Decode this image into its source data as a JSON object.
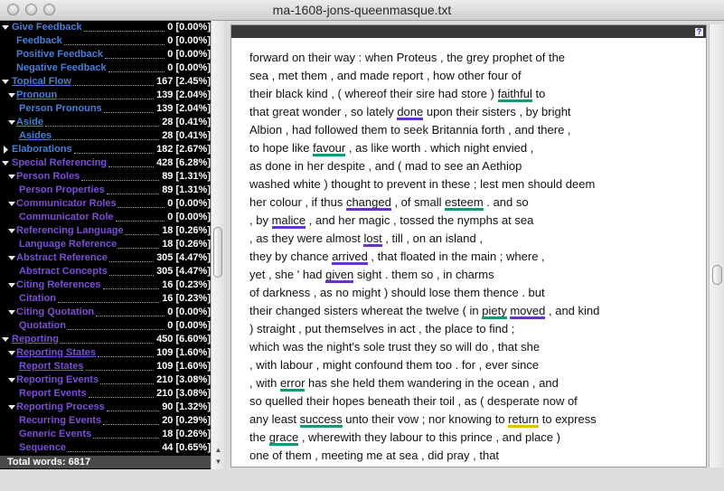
{
  "window": {
    "title": "ma-1608-jons-queenmasque.txt"
  },
  "colors": {
    "purple": "#6633cc",
    "teal": "#119977",
    "yellow": "#e6c000",
    "blue_label": "#3366cc",
    "purple_label": "#7a4fd4"
  },
  "tree": [
    {
      "label": "Give Feedback",
      "value": "0 [0.00%]",
      "level": 0,
      "tri": "down",
      "color": "#4a7fd8"
    },
    {
      "label": "Feedback",
      "value": "0 [0.00%]",
      "level": 1,
      "tri": "",
      "color": "#4a7fd8"
    },
    {
      "label": "Positive Feedback",
      "value": "0 [0.00%]",
      "level": 1,
      "tri": "",
      "color": "#4a7fd8"
    },
    {
      "label": "Negative Feedback",
      "value": "0 [0.00%]",
      "level": 1,
      "tri": "",
      "color": "#4a7fd8"
    },
    {
      "label": "Topical Flow",
      "value": "167 [2.45%]",
      "level": 0,
      "tri": "down",
      "color": "#4a7fd8",
      "underline": true
    },
    {
      "label": "Pronoun",
      "value": "139 [2.04%]",
      "level": 1,
      "tri": "down",
      "color": "#4a7fd8",
      "underline": true,
      "tri_offset": true
    },
    {
      "label": "Person Pronouns",
      "value": "139 [2.04%]",
      "level": 2,
      "tri": "",
      "color": "#4a7fd8"
    },
    {
      "label": "Aside",
      "value": "28 [0.41%]",
      "level": 1,
      "tri": "down",
      "color": "#4a7fd8",
      "underline": true,
      "tri_offset": true
    },
    {
      "label": "Asides",
      "value": "28 [0.41%]",
      "level": 2,
      "tri": "",
      "color": "#4a7fd8",
      "underline": true
    },
    {
      "label": "Elaborations",
      "value": "182 [2.67%]",
      "level": 0,
      "tri": "right",
      "color": "#4a7fd8"
    },
    {
      "label": "Special Referencing",
      "value": "428 [6.28%]",
      "level": 0,
      "tri": "down",
      "color": "#7a4fd4"
    },
    {
      "label": "Person Roles",
      "value": "89 [1.31%]",
      "level": 1,
      "tri": "down",
      "color": "#7a4fd4",
      "tri_offset": true
    },
    {
      "label": "Person Properties",
      "value": "89 [1.31%]",
      "level": 2,
      "tri": "",
      "color": "#7a4fd4"
    },
    {
      "label": "Communicator Roles",
      "value": "0 [0.00%]",
      "level": 1,
      "tri": "down",
      "color": "#7a4fd4",
      "tri_offset": true
    },
    {
      "label": "Communicator Role",
      "value": "0 [0.00%]",
      "level": 2,
      "tri": "",
      "color": "#7a4fd4"
    },
    {
      "label": "Referencing Language",
      "value": "18 [0.26%]",
      "level": 1,
      "tri": "down",
      "color": "#7a4fd4",
      "tri_offset": true
    },
    {
      "label": "Language Reference",
      "value": "18 [0.26%]",
      "level": 2,
      "tri": "",
      "color": "#7a4fd4"
    },
    {
      "label": "Abstract Reference",
      "value": "305 [4.47%]",
      "level": 1,
      "tri": "down",
      "color": "#7a4fd4",
      "tri_offset": true
    },
    {
      "label": "Abstract Concepts",
      "value": "305 [4.47%]",
      "level": 2,
      "tri": "",
      "color": "#7a4fd4"
    },
    {
      "label": "Citing References",
      "value": "16 [0.23%]",
      "level": 1,
      "tri": "down",
      "color": "#7a4fd4",
      "tri_offset": true
    },
    {
      "label": "Citation",
      "value": "16 [0.23%]",
      "level": 2,
      "tri": "",
      "color": "#7a4fd4"
    },
    {
      "label": "Citing Quotation",
      "value": "0 [0.00%]",
      "level": 1,
      "tri": "down",
      "color": "#7a4fd4",
      "tri_offset": true
    },
    {
      "label": "Quotation",
      "value": "0 [0.00%]",
      "level": 2,
      "tri": "",
      "color": "#7a4fd4"
    },
    {
      "label": "Reporting",
      "value": "450 [6.60%]",
      "level": 0,
      "tri": "down",
      "color": "#7a4fd4",
      "underline": true
    },
    {
      "label": "Reporting States",
      "value": "109 [1.60%]",
      "level": 1,
      "tri": "down",
      "color": "#7a4fd4",
      "underline": true,
      "tri_offset": true
    },
    {
      "label": "Report States",
      "value": "109 [1.60%]",
      "level": 2,
      "tri": "",
      "color": "#7a4fd4",
      "underline": true
    },
    {
      "label": "Reporting Events",
      "value": "210 [3.08%]",
      "level": 1,
      "tri": "down",
      "color": "#7a4fd4",
      "tri_offset": true
    },
    {
      "label": "Report Events",
      "value": "210 [3.08%]",
      "level": 2,
      "tri": "",
      "color": "#7a4fd4"
    },
    {
      "label": "Reporting Process",
      "value": "90 [1.32%]",
      "level": 1,
      "tri": "down",
      "color": "#7a4fd4",
      "tri_offset": true
    },
    {
      "label": "Recurring Events",
      "value": "20 [0.29%]",
      "level": 2,
      "tri": "",
      "color": "#7a4fd4"
    },
    {
      "label": "Generic Events",
      "value": "18 [0.26%]",
      "level": 2,
      "tri": "",
      "color": "#7a4fd4"
    },
    {
      "label": "Sequence",
      "value": "44 [0.65%]",
      "level": 2,
      "tri": "",
      "color": "#7a4fd4"
    }
  ],
  "total_words": "Total words: 6817",
  "help_label": "?",
  "text_lines": [
    [
      {
        "t": "forward on their way : when Proteus , the grey prophet of the"
      }
    ],
    [
      {
        "t": "sea , met them , and made report , how other four of"
      }
    ],
    [
      {
        "t": "their black kind , ( whereof their sire had store ) "
      },
      {
        "t": "faithful",
        "hl": "teal"
      },
      {
        "t": " to"
      }
    ],
    [
      {
        "t": "that great wonder , so lately "
      },
      {
        "t": "done",
        "hl": "purple"
      },
      {
        "t": " upon their sisters , by bright"
      }
    ],
    [
      {
        "t": "Albion , had followed them to seek Britannia forth , and there ,"
      }
    ],
    [
      {
        "t": "to hope like "
      },
      {
        "t": "favour",
        "hl": "teal"
      },
      {
        "t": " , as like worth . which night envied ,"
      }
    ],
    [
      {
        "t": "as done in her despite , and ( mad to see an Aethiop"
      }
    ],
    [
      {
        "t": "washed white ) thought to prevent in these ; lest men should deem"
      }
    ],
    [
      {
        "t": "her colour , if thus "
      },
      {
        "t": "changed",
        "hl": "purple"
      },
      {
        "t": " , of small "
      },
      {
        "t": "esteem",
        "hl": "teal"
      },
      {
        "t": " . and so"
      }
    ],
    [
      {
        "t": ", by "
      },
      {
        "t": "malice",
        "hl": "purple"
      },
      {
        "t": " , and her magic , tossed the nymphs at sea"
      }
    ],
    [
      {
        "t": ", as they were almost "
      },
      {
        "t": "lost",
        "hl": "purple"
      },
      {
        "t": " , till , on an island ,"
      }
    ],
    [
      {
        "t": "they by chance "
      },
      {
        "t": "arrived",
        "hl": "purple"
      },
      {
        "t": " , that floated in the main ; where ,"
      }
    ],
    [
      {
        "t": "yet , she ' had "
      },
      {
        "t": "given",
        "hl": "purple"
      },
      {
        "t": " sight . them so , in charms"
      }
    ],
    [
      {
        "t": "of darkness , as no might ) should lose them thence . but"
      }
    ],
    [
      {
        "t": "their changed sisters whereat the twelve ( in "
      },
      {
        "t": "piety",
        "hl": "teal"
      },
      {
        "t": " "
      },
      {
        "t": "moved",
        "hl": "purple"
      },
      {
        "t": " , and kind"
      }
    ],
    [
      {
        "t": ") straight , put themselves in act , the place to find ;"
      }
    ],
    [
      {
        "t": "which was the night's sole trust they so will do , that she"
      }
    ],
    [
      {
        "t": ", with labour , might confound them too . for , ever since"
      }
    ],
    [
      {
        "t": ", with "
      },
      {
        "t": "error",
        "hl": "teal"
      },
      {
        "t": " has she held them wandering in the ocean , and"
      }
    ],
    [
      {
        "t": "so quelled their hopes beneath their toil , as ( desperate now of"
      }
    ],
    [
      {
        "t": "any least "
      },
      {
        "t": "success",
        "hl": "teal"
      },
      {
        "t": " unto their vow ; nor knowing to "
      },
      {
        "t": "return",
        "hl": "yellow"
      },
      {
        "t": " to express"
      }
    ],
    [
      {
        "t": "the "
      },
      {
        "t": "grace",
        "hl": "teal"
      },
      {
        "t": " , wherewith they labour to this prince , and place )"
      }
    ],
    [
      {
        "t": "one of them , meeting me at sea , did pray , that"
      }
    ]
  ]
}
